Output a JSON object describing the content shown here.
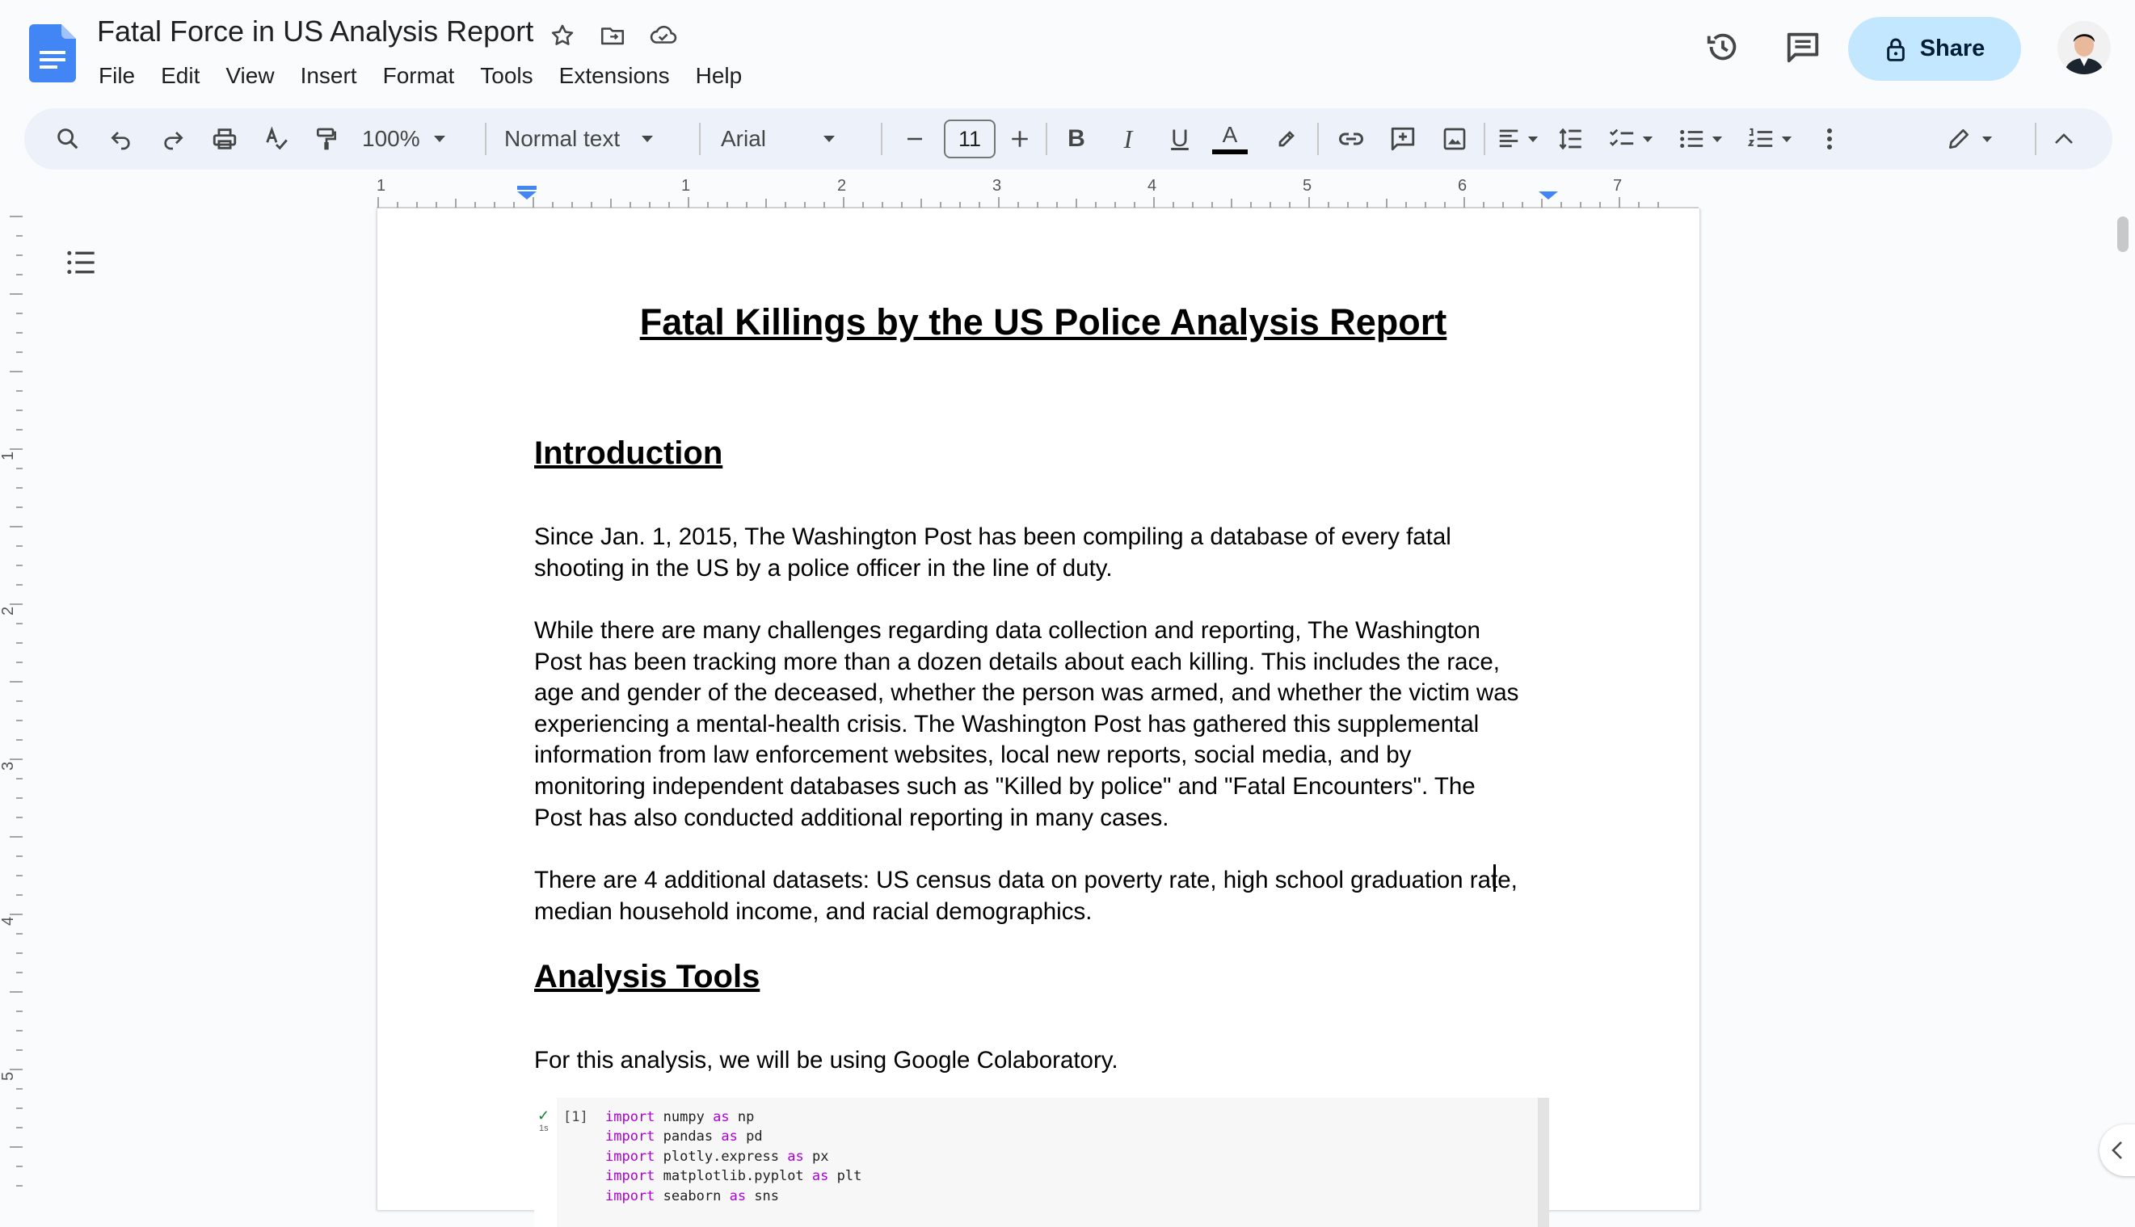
{
  "app": {
    "doc_title": "Fatal Force in US Analysis Report",
    "menu": [
      "File",
      "Edit",
      "View",
      "Insert",
      "Format",
      "Tools",
      "Extensions",
      "Help"
    ],
    "share_label": "Share"
  },
  "toolbar": {
    "zoom": "100%",
    "style": "Normal text",
    "font": "Arial",
    "font_size": "11"
  },
  "ruler": {
    "marks": [
      "1",
      "1",
      "2",
      "3",
      "4",
      "5",
      "6",
      "7"
    ],
    "vertical_marks": [
      "1",
      "2",
      "3",
      "4",
      "5"
    ]
  },
  "document": {
    "title": "Fatal Killings by the US Police Analysis Report",
    "intro_heading": "Introduction",
    "intro_p1_lines": [
      "Since Jan. 1, 2015, The Washington Post has been compiling a database of every fatal",
      "shooting in the US by a police officer in the line of duty."
    ],
    "intro_p2_lines": [
      "While there are many challenges regarding data collection and reporting, The Washington",
      "Post has been tracking more than a dozen details about each killing. This includes the race,",
      "age and gender of the deceased, whether the person was armed, and whether the victim was",
      "experiencing a mental-health crisis. The Washington Post has gathered this supplemental",
      "information from law enforcement websites, local new reports, social media, and by",
      "monitoring independent databases such as \"Killed by police\" and \"Fatal Encounters\". The",
      "Post has also conducted additional reporting in many cases."
    ],
    "intro_p3_lines": [
      "There are 4 additional datasets: US census data on poverty rate, high school graduation rate,",
      "median household income, and racial demographics."
    ],
    "tools_heading": "Analysis Tools",
    "tools_p": "For this analysis, we will be using Google Colaboratory.",
    "code_cell": {
      "prompt": "[1]",
      "time": "1s",
      "lines": [
        {
          "kw": "import",
          "mod": "numpy",
          "as": "as",
          "alias": "np"
        },
        {
          "kw": "import",
          "mod": "pandas",
          "as": "as",
          "alias": "pd"
        },
        {
          "kw": "import",
          "mod": "plotly.express",
          "as": "as",
          "alias": "px"
        },
        {
          "kw": "import",
          "mod": "matplotlib.pyplot",
          "as": "as",
          "alias": "plt"
        },
        {
          "kw": "import",
          "mod": "seaborn",
          "as": "as",
          "alias": "sns"
        }
      ]
    }
  },
  "colors": {
    "docs_blue": "#4285f4",
    "share_bg": "#c2e7ff",
    "toolbar_bg": "#edf2fa",
    "ruler_marker": "#4285f4",
    "code_keyword": "#af00db"
  },
  "icons": [
    "docs-logo",
    "star-icon",
    "move-folder-icon",
    "cloud-saved-icon",
    "history-icon",
    "comment-icon",
    "lock-icon",
    "search-icon",
    "undo-icon",
    "redo-icon",
    "print-icon",
    "spellcheck-icon",
    "paint-format-icon",
    "link-icon",
    "add-comment-icon",
    "image-icon",
    "align-icon",
    "line-spacing-icon",
    "checklist-icon",
    "bullet-list-icon",
    "numbered-list-icon",
    "more-icon",
    "edit-mode-icon",
    "collapse-icon",
    "outline-icon"
  ]
}
